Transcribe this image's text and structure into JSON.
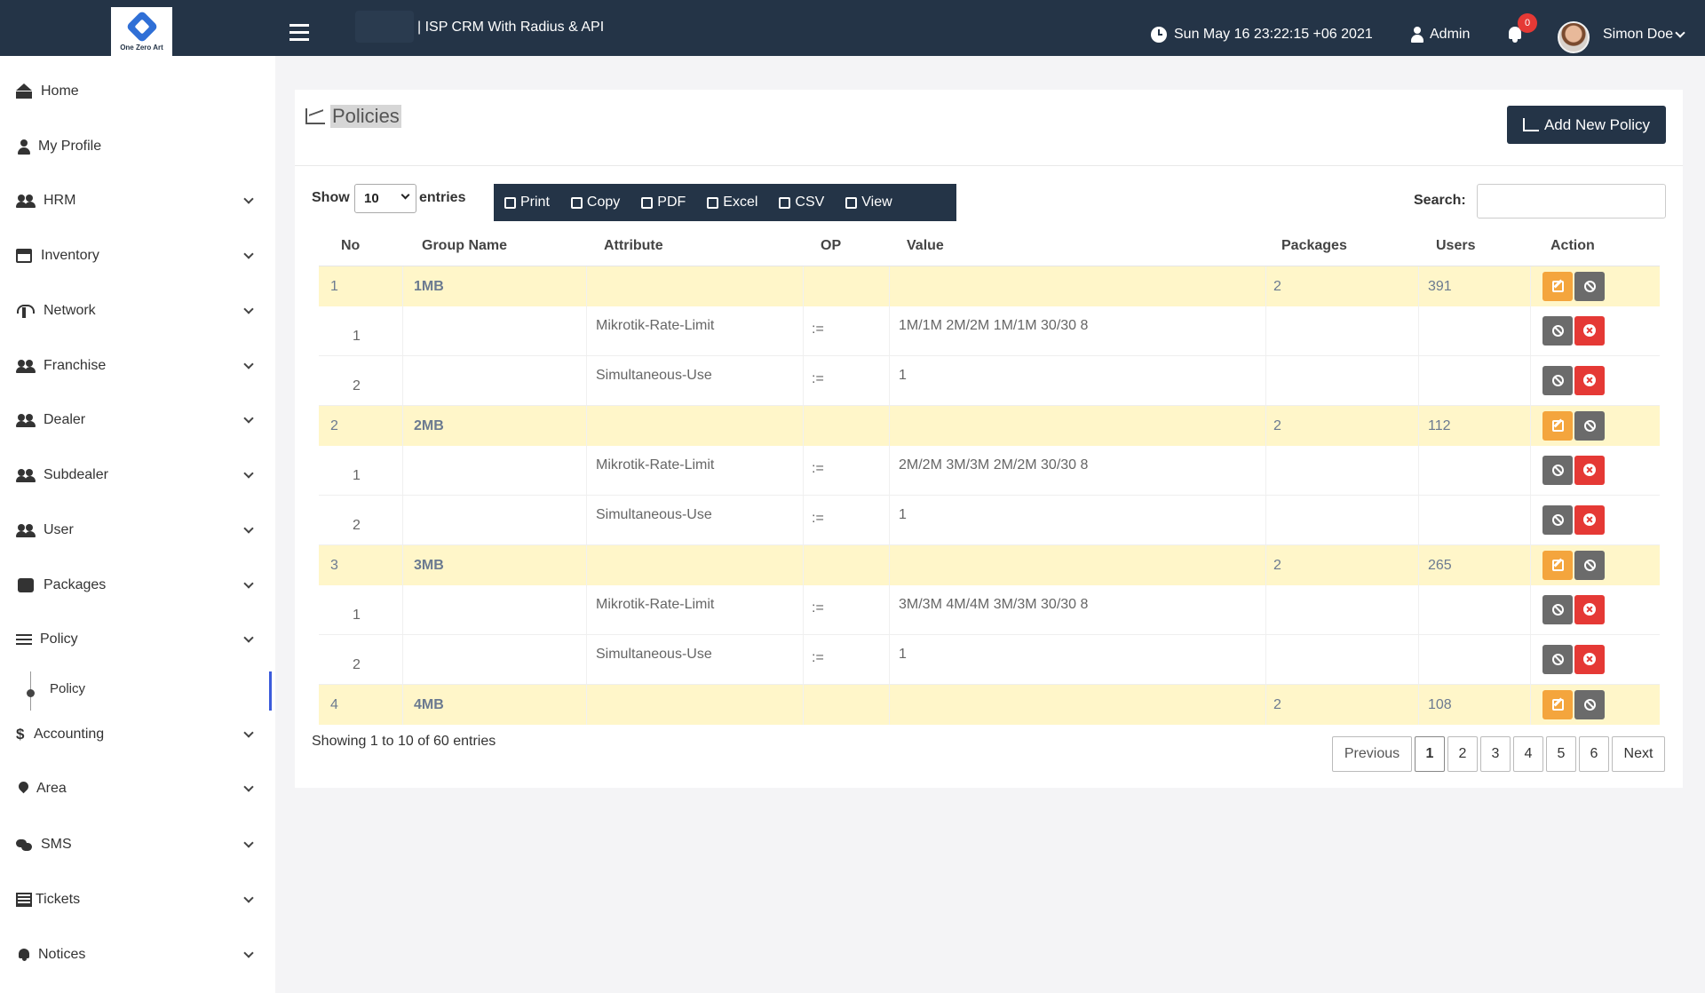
{
  "header": {
    "logo_text": "One Zero Art",
    "app_title": "| ISP CRM With Radius & API",
    "datetime": "Sun May 16 23:22:15 +06 2021",
    "role": "Admin",
    "notification_count": "0",
    "user_name": "Simon Doe"
  },
  "sidebar": {
    "items": [
      {
        "label": "Home",
        "icon": "home-icon"
      },
      {
        "label": "My Profile",
        "icon": "user-icon"
      },
      {
        "label": "HRM",
        "icon": "users-icon"
      },
      {
        "label": "Inventory",
        "icon": "inventory-icon"
      },
      {
        "label": "Network",
        "icon": "network-icon"
      },
      {
        "label": "Franchise",
        "icon": "users-icon"
      },
      {
        "label": "Dealer",
        "icon": "users-icon"
      },
      {
        "label": "Subdealer",
        "icon": "users-icon"
      },
      {
        "label": "User",
        "icon": "users-icon"
      },
      {
        "label": "Packages",
        "icon": "packages-icon"
      },
      {
        "label": "Policy",
        "icon": "sliders-icon"
      },
      {
        "label": "Accounting",
        "icon": "dollar-icon"
      },
      {
        "label": "Area",
        "icon": "map-pin-icon"
      },
      {
        "label": "SMS",
        "icon": "chat-icon"
      },
      {
        "label": "Tickets",
        "icon": "ticket-icon"
      },
      {
        "label": "Notices",
        "icon": "bell-icon"
      }
    ],
    "policy_sub_item": "Policy"
  },
  "page": {
    "title": "Policies",
    "add_button": "Add New Policy",
    "show_label": "Show",
    "entries_per_page": "10",
    "entries_label": "entries",
    "toolbar": [
      "Print",
      "Copy",
      "PDF",
      "Excel",
      "CSV",
      "View"
    ],
    "search_label": "Search:",
    "search_value": "",
    "info": "Showing 1 to 10 of 60 entries",
    "pagination": {
      "previous": "Previous",
      "pages": [
        "1",
        "2",
        "3",
        "4",
        "5",
        "6"
      ],
      "active": "1",
      "next": "Next"
    }
  },
  "table": {
    "columns": [
      "No",
      "Group Name",
      "Attribute",
      "OP",
      "Value",
      "Packages",
      "Users",
      "Action"
    ],
    "groups": [
      {
        "no": "1",
        "name": "1MB",
        "packages": "2",
        "users": "391",
        "attributes": [
          {
            "no": "1",
            "attribute": "Mikrotik-Rate-Limit",
            "op": ":=",
            "value": "1M/1M 2M/2M 1M/1M 30/30 8"
          },
          {
            "no": "2",
            "attribute": "Simultaneous-Use",
            "op": ":=",
            "value": "1"
          }
        ]
      },
      {
        "no": "2",
        "name": "2MB",
        "packages": "2",
        "users": "112",
        "attributes": [
          {
            "no": "1",
            "attribute": "Mikrotik-Rate-Limit",
            "op": ":=",
            "value": "2M/2M 3M/3M 2M/2M 30/30 8"
          },
          {
            "no": "2",
            "attribute": "Simultaneous-Use",
            "op": ":=",
            "value": "1"
          }
        ]
      },
      {
        "no": "3",
        "name": "3MB",
        "packages": "2",
        "users": "265",
        "attributes": [
          {
            "no": "1",
            "attribute": "Mikrotik-Rate-Limit",
            "op": ":=",
            "value": "3M/3M 4M/4M 3M/3M 30/30 8"
          },
          {
            "no": "2",
            "attribute": "Simultaneous-Use",
            "op": ":=",
            "value": "1"
          }
        ]
      },
      {
        "no": "4",
        "name": "4MB",
        "packages": "2",
        "users": "108",
        "attributes": []
      }
    ]
  },
  "colors": {
    "topbar": "#243447",
    "group_row": "#fff6c9",
    "edit_button": "#f4a53d",
    "block_button": "#6b6b6b",
    "delete_button": "#e53935"
  }
}
